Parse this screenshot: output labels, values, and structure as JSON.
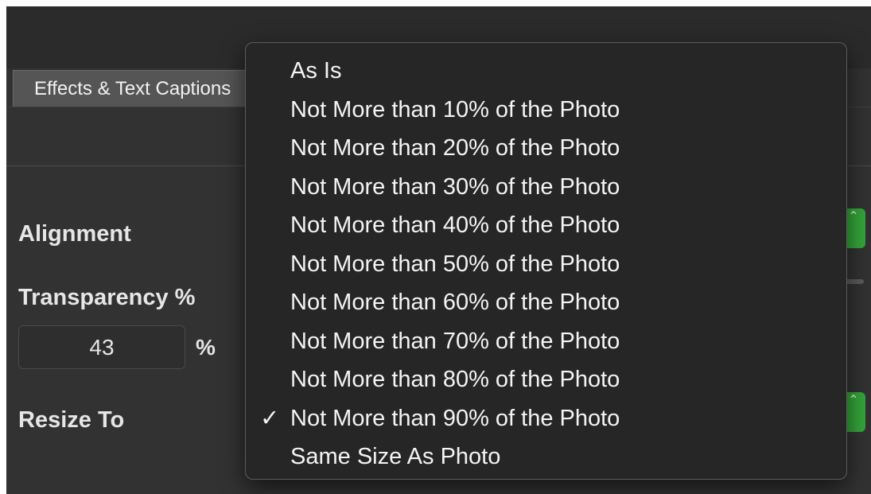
{
  "tabs": [
    {
      "label": "Effects & Text Captions"
    }
  ],
  "form": {
    "alignment_label": "Alignment",
    "transparency_label": "Transparency %",
    "transparency_value": "43",
    "percent_unit": "%",
    "resize_label": "Resize To"
  },
  "stepper_glyph": "⌃",
  "resize_menu": {
    "selected_index": 9,
    "check_glyph": "✓",
    "items": [
      "As Is",
      "Not More than 10% of the Photo",
      "Not More than 20% of the Photo",
      "Not More than 30% of the Photo",
      "Not More than 40% of the Photo",
      "Not More than 50% of the Photo",
      "Not More than 60% of the Photo",
      "Not More than 70% of the Photo",
      "Not More than 80% of the Photo",
      "Not More than 90% of the Photo",
      "Same Size As Photo"
    ]
  },
  "colors": {
    "panel_bg": "#323232",
    "menu_bg": "#262626",
    "accent_green": "#34a53a",
    "text": "#e6e6e6"
  }
}
